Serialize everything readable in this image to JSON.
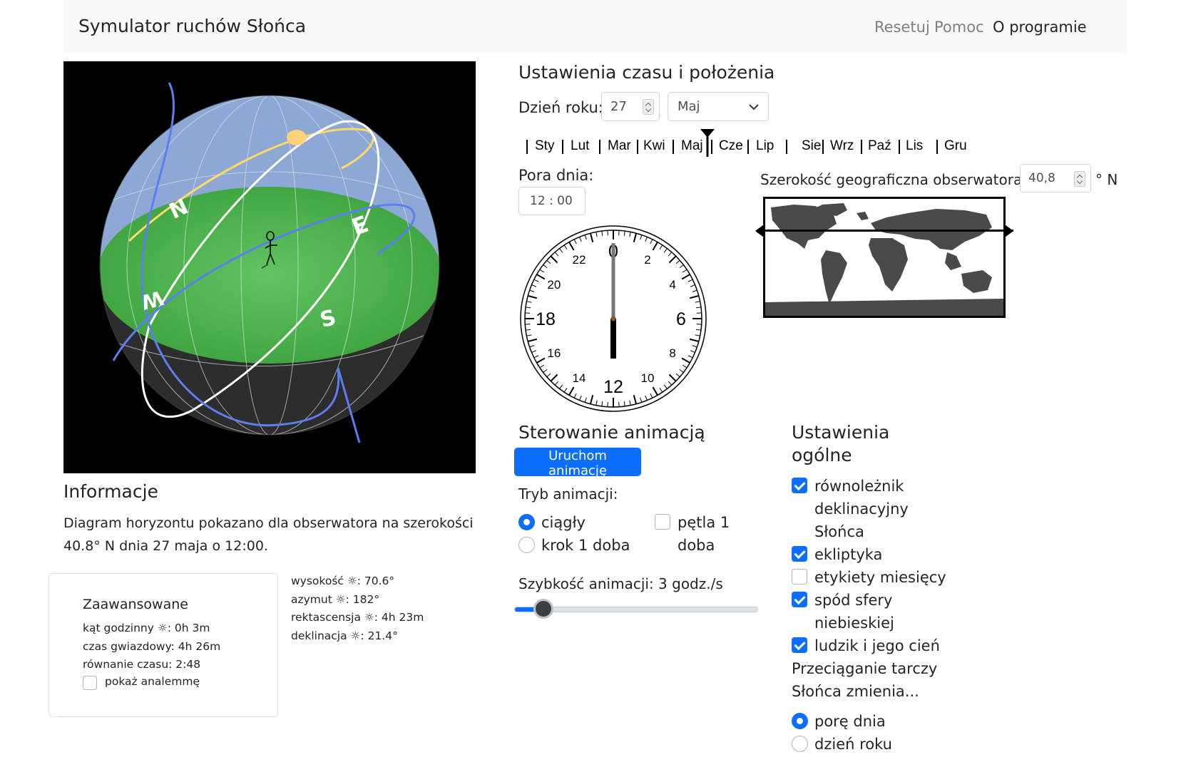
{
  "app": {
    "title": "Symulator ruchów Słońca",
    "nav": [
      {
        "label": "Resetuj"
      },
      {
        "label": "Pomoc"
      },
      {
        "label": "O programie"
      }
    ]
  },
  "sphere": {
    "labels": {
      "n": "N",
      "e": "E",
      "w": "W",
      "s": "S"
    },
    "colors": {
      "sky": "#8ea8d6",
      "horizon": "#4caf50",
      "underside": "#2d2d2d",
      "ecliptic": "#ffd966",
      "sun_path": "#ffffff",
      "meridian": "#5b7ff0",
      "sun": "#ffd27a"
    }
  },
  "info": {
    "heading": "Informacje",
    "text": "Diagram horyzontu pokazano dla obserwatora na szerokości 40.8° N dnia 27 maja o 12:00."
  },
  "advanced": {
    "heading": "Zaawansowane",
    "hour_angle": "kąt godzinny ☼: 0h 3m",
    "sidereal_time": "czas gwiazdowy: 4h 26m",
    "equation_of_time": "równanie czasu: 2:48",
    "show_analemma": "pokaż analemmę",
    "show_analemma_checked": false,
    "altitude": "wysokość ☼: 70.6°",
    "azimuth": "azymut ☼: 182°",
    "right_ascension": "rektascensja ☼: 4h 23m",
    "declination": "deklinacja ☼: 21.4°"
  },
  "time_settings": {
    "heading": "Ustawienia czasu i położenia",
    "day_label": "Dzień roku:",
    "day_value": "27",
    "month_value": "Maj",
    "months": [
      "Sty",
      "Lut",
      "Mar",
      "Kwi",
      "Maj",
      "Cze",
      "Lip",
      "Sie",
      "Wrz",
      "Paź",
      "Lis",
      "Gru"
    ],
    "time_label": "Pora dnia:",
    "time_value": "12 : 00",
    "latitude_label": "Szerokość geograficzna obserwatora:",
    "latitude_value": "40,8",
    "latitude_unit": "° N"
  },
  "clock": {
    "numbers": [
      "0",
      "2",
      "4",
      "6",
      "8",
      "10",
      "12",
      "14",
      "16",
      "18",
      "20",
      "22"
    ],
    "hour_hand_angle_deg": 180
  },
  "animation": {
    "heading": "Sterowanie animacją",
    "start_button": "Uruchom animację",
    "mode_label": "Tryb animacji:",
    "mode_continuous": "ciągły",
    "mode_step": "krok 1 doba",
    "loop_line1": "pętla 1",
    "loop_line2": "doba",
    "selected_mode": "ciągły",
    "loop_checked": false,
    "speed_label": "Szybkość animacji: 3 godz./s",
    "speed_fraction": 0.12
  },
  "general": {
    "heading_line1": "Ustawienia",
    "heading_line2": "ogólne",
    "opt1_line1": "równoleżnik",
    "opt1_line2": "deklinacyjny",
    "opt1_line3": "Słońca",
    "opt1_checked": true,
    "opt2": "ekliptyka",
    "opt2_checked": true,
    "opt3": "etykiety miesięcy",
    "opt3_checked": false,
    "opt4_line1": "spód sfery",
    "opt4_line2": "niebieskiej",
    "opt4_checked": true,
    "opt5": "ludzik i jego cień",
    "opt5_checked": true,
    "drag_line1": "Przeciąganie tarczy",
    "drag_line2": "Słońca zmienia...",
    "drag_opt1": "porę dnia",
    "drag_opt2": "dzień roku",
    "drag_selected": "porę dnia"
  }
}
